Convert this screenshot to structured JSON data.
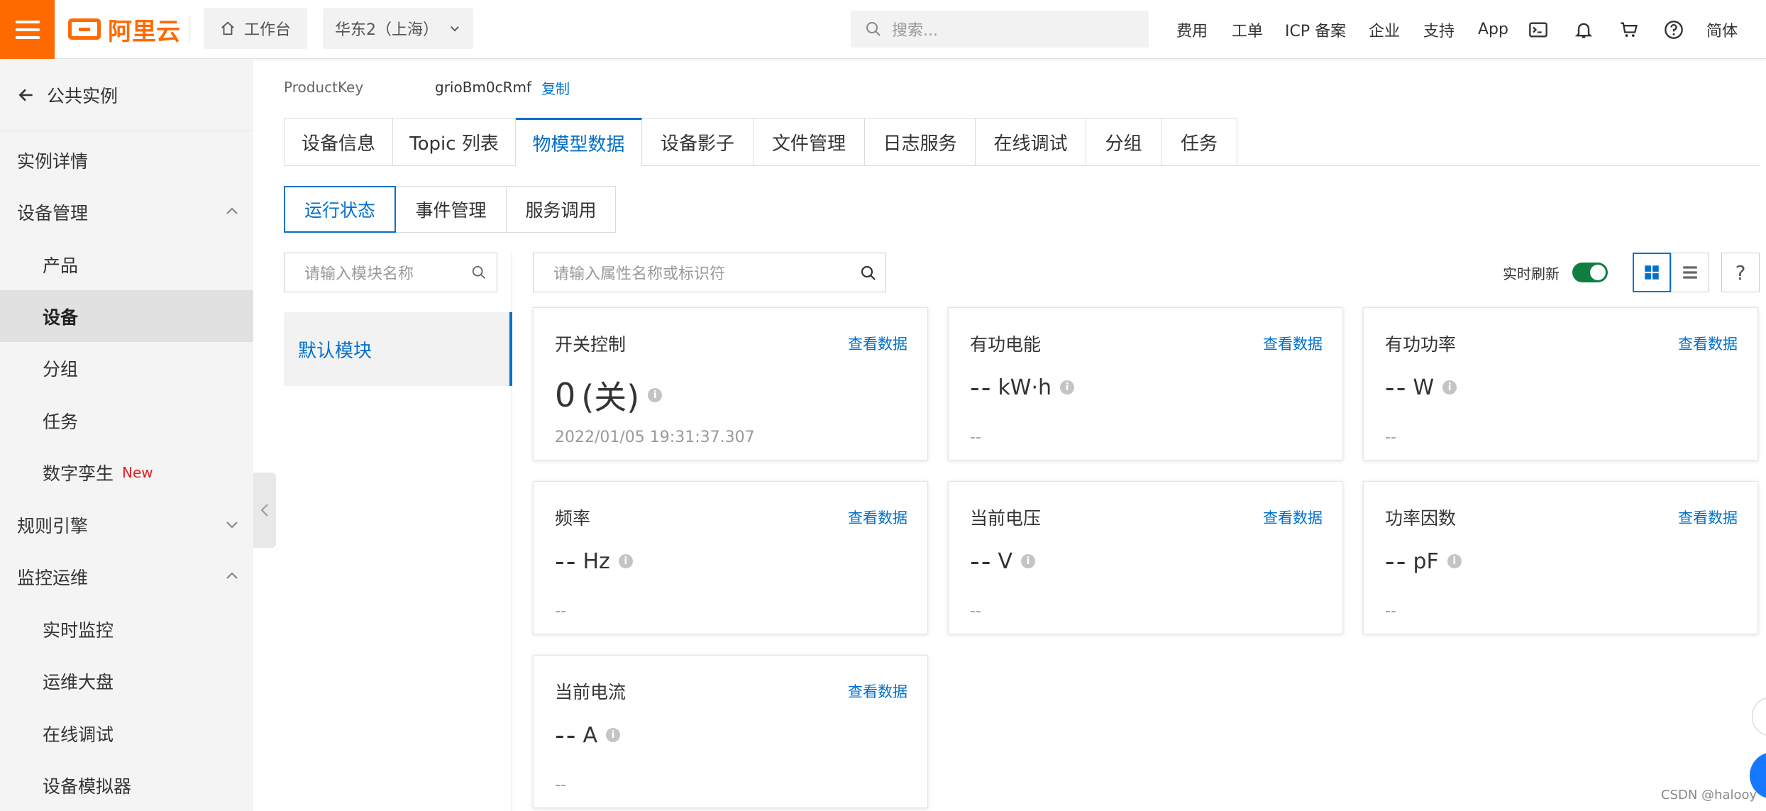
{
  "topbar": {
    "logo_text": "阿里云",
    "workbench_label": "工作台",
    "region_label": "华东2（上海）",
    "search_placeholder": "搜索...",
    "nav": [
      "费用",
      "工单",
      "ICP 备案",
      "企业",
      "支持",
      "App"
    ],
    "lang_label": "简体",
    "icons": [
      "terminal-icon",
      "bell-icon",
      "cart-icon",
      "help-circle-icon"
    ]
  },
  "sidebar": {
    "back_label": "公共实例",
    "items": [
      {
        "label": "实例详情",
        "level": 1
      },
      {
        "label": "设备管理",
        "level": 1,
        "expanded": true
      },
      {
        "label": "产品",
        "level": 2
      },
      {
        "label": "设备",
        "level": 2,
        "active": true
      },
      {
        "label": "分组",
        "level": 2
      },
      {
        "label": "任务",
        "level": 2
      },
      {
        "label": "数字孪生",
        "level": 2,
        "badge": "New"
      },
      {
        "label": "规则引擎",
        "level": 1,
        "expanded": false
      },
      {
        "label": "监控运维",
        "level": 1,
        "expanded": true
      },
      {
        "label": "实时监控",
        "level": 2
      },
      {
        "label": "运维大盘",
        "level": 2
      },
      {
        "label": "在线调试",
        "level": 2
      },
      {
        "label": "设备模拟器",
        "level": 2
      }
    ]
  },
  "product": {
    "key_label": "ProductKey",
    "key_value": "grioBm0cRmf",
    "copy_label": "复制"
  },
  "main_tabs": [
    {
      "label": "设备信息"
    },
    {
      "label": "Topic 列表"
    },
    {
      "label": "物模型数据",
      "active": true
    },
    {
      "label": "设备影子"
    },
    {
      "label": "文件管理"
    },
    {
      "label": "日志服务"
    },
    {
      "label": "在线调试"
    },
    {
      "label": "分组"
    },
    {
      "label": "任务"
    }
  ],
  "sub_tabs": [
    {
      "label": "运行状态",
      "active": true
    },
    {
      "label": "事件管理"
    },
    {
      "label": "服务调用"
    }
  ],
  "module_search_placeholder": "请输入模块名称",
  "module_item": "默认模块",
  "property_search_placeholder": "请输入属性名称或标识符",
  "realtime_refresh": {
    "label": "实时刷新",
    "enabled": true
  },
  "view_modes": {
    "active": "grid"
  },
  "help_label": "?",
  "cards": [
    {
      "title": "开关控制",
      "link": "查看数据",
      "value": "0",
      "unit": "(关)",
      "time": "2022/01/05 19:31:37.307"
    },
    {
      "title": "有功电能",
      "link": "查看数据",
      "value": "--",
      "unit": "kW·h",
      "time": "--"
    },
    {
      "title": "有功功率",
      "link": "查看数据",
      "value": "--",
      "unit": "W",
      "time": "--"
    },
    {
      "title": "频率",
      "link": "查看数据",
      "value": "--",
      "unit": "Hz",
      "time": "--"
    },
    {
      "title": "当前电压",
      "link": "查看数据",
      "value": "--",
      "unit": "V",
      "time": "--"
    },
    {
      "title": "功率因数",
      "link": "查看数据",
      "value": "--",
      "unit": "pF",
      "time": "--"
    },
    {
      "title": "当前电流",
      "link": "查看数据",
      "value": "--",
      "unit": "A",
      "time": "--"
    }
  ],
  "watermark": "CSDN @halooy",
  "colors": {
    "brand": "#ff6a00",
    "link": "#0070cc",
    "toggle_on": "#0e7f3e"
  }
}
